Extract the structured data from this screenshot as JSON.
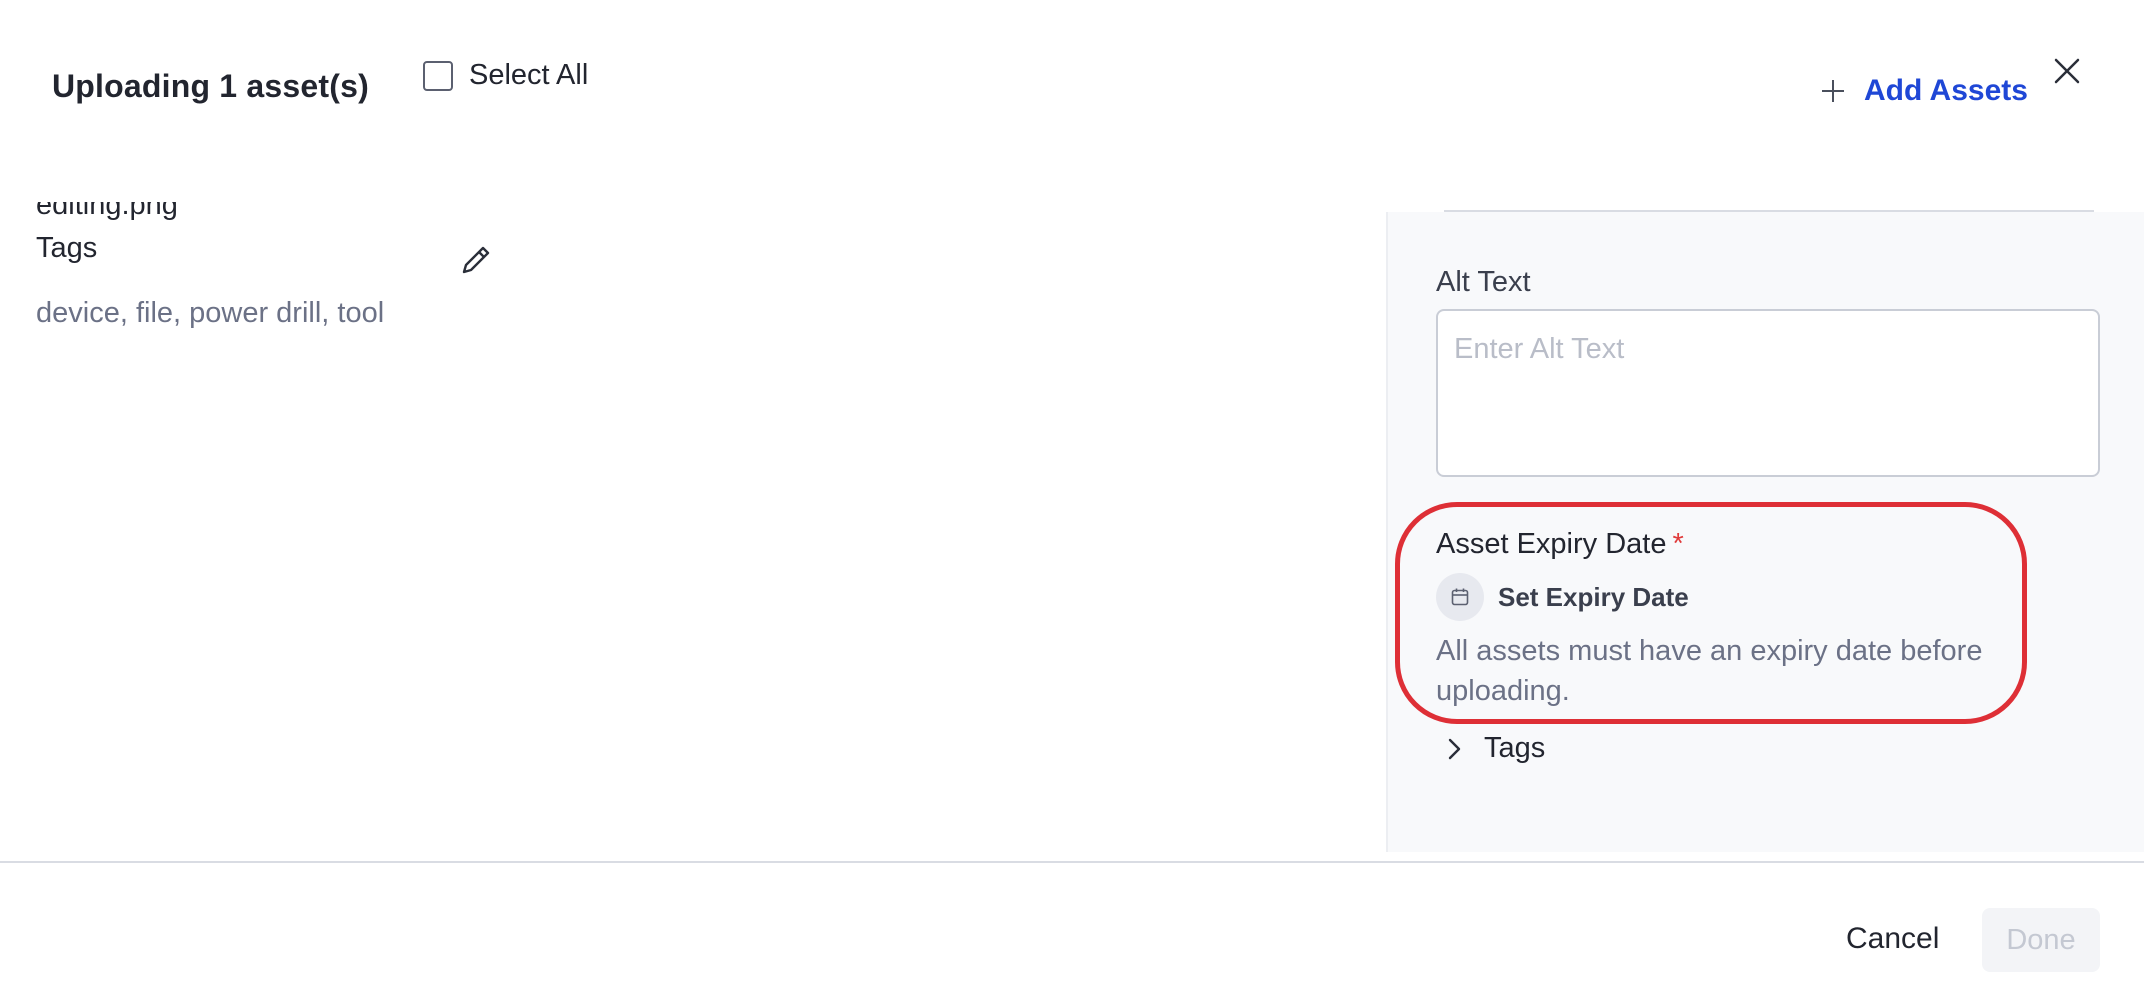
{
  "header": {
    "title": "Uploading 1 asset(s)",
    "select_all_label": "Select All",
    "select_all_checked": false,
    "add_assets_label": "Add Assets"
  },
  "asset": {
    "filename": "editing.png",
    "tags_heading": "Tags",
    "tags_value": "device, file, power drill, tool"
  },
  "panel": {
    "alt_text_label": "Alt Text",
    "alt_text_placeholder": "Enter Alt Text",
    "alt_text_value": "",
    "expiry_label": "Asset Expiry Date",
    "required_marker": "*",
    "set_expiry_label": "Set Expiry Date",
    "expiry_help": "All assets must have an expiry date before uploading.",
    "tags_section_label": "Tags"
  },
  "footer": {
    "cancel_label": "Cancel",
    "done_label": "Done",
    "done_enabled": false
  },
  "icons": {
    "plus": "plus-icon",
    "close": "close-icon",
    "edit": "pencil-icon",
    "calendar": "calendar-icon",
    "chevron": "chevron-right-icon"
  },
  "colors": {
    "accent": "#1f47d6",
    "highlight": "#de2f36",
    "required": "#e03a3a",
    "panel_background": "#f8f9fb",
    "muted_text": "#6b7186"
  }
}
